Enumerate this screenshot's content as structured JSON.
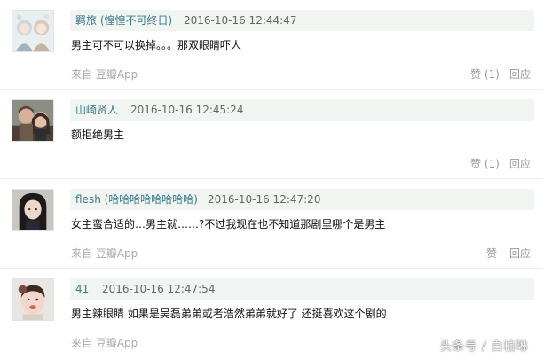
{
  "comments": [
    {
      "author": "羁旅 (惶惶不可终日)",
      "time": "2016-10-16 12:44:47",
      "text": "男主可不可以换掉。。。那双眼睛吓人",
      "source": "来自 豆瓣App",
      "like": "赞 (1)",
      "reply": "回应",
      "avatar": "illustrated-girls-avatar"
    },
    {
      "author": "山崎贤人",
      "time": "2016-10-16 12:45:24",
      "text": "额拒绝男主",
      "source": "",
      "like": "赞 (1)",
      "reply": "回应",
      "avatar": "couple-photo-avatar"
    },
    {
      "author": "flesh (哈哈哈哈哈哈哈哈)",
      "time": "2016-10-16 12:47:20",
      "text": "女主蛮合适的…男主就……?不过我现在也不知道那剧里哪个是男主",
      "source": "来自 豆瓣App",
      "like": "赞",
      "reply": "回应",
      "avatar": "dark-hair-girl-avatar"
    },
    {
      "author": "41",
      "time": "2016-10-16 12:47:54",
      "text": "男主辣眼睛 如果是吴磊弟弟或者浩然弟弟就好了 还挺喜欢这个剧的",
      "source": "来自 豆瓣App",
      "like": "",
      "reply": "",
      "avatar": "child-photo-avatar"
    }
  ],
  "watermark": "头条号 / 白柏琳",
  "colors": {
    "header_bg": "#f0f5f1",
    "author": "#3a7a8c",
    "meta": "#999999"
  }
}
